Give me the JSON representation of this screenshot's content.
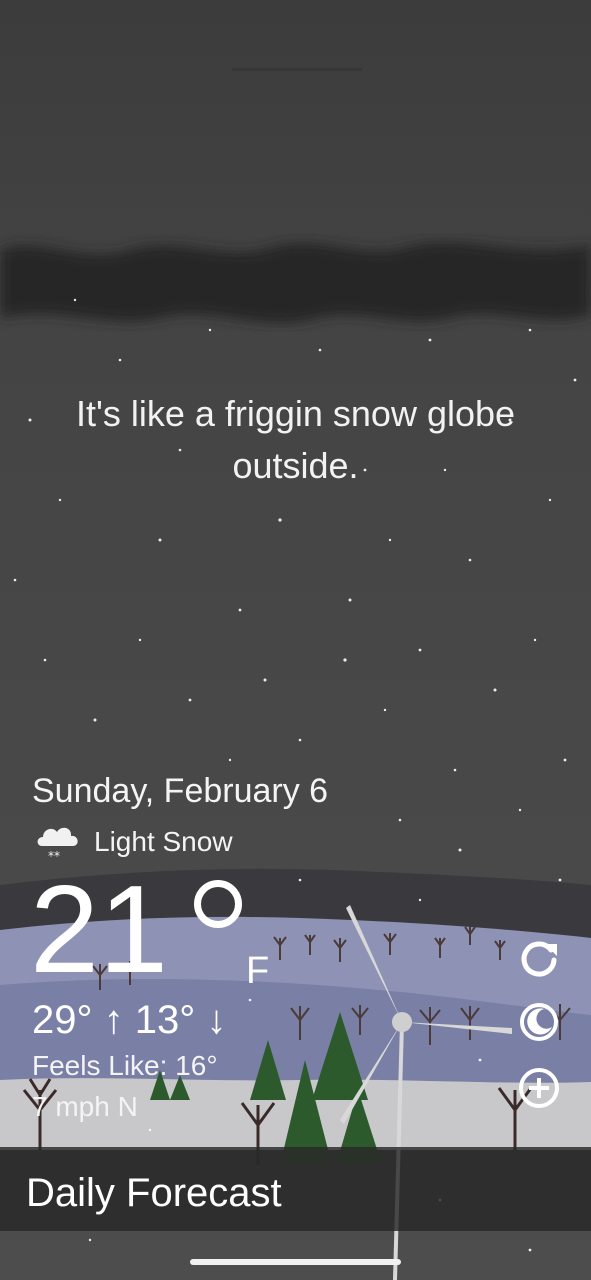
{
  "weather": {
    "quote": "It's like a friggin snow globe outside.",
    "date": "Sunday, February 6",
    "condition": "Light Snow",
    "condition_icon": "snow-cloud-icon",
    "temperature": "21",
    "unit": "F",
    "hi_lo": "29° ↑  13° ↓",
    "feels_like": "Feels Like: 16°",
    "wind": "7 mph N"
  },
  "actions": {
    "refresh_icon": "refresh-icon",
    "theme_icon": "moon-icon",
    "add_icon": "plus-circle-icon"
  },
  "forecast": {
    "label": "Daily Forecast"
  },
  "colors": {
    "sky": "#4a4a4a",
    "cloud": "#2a2a2a",
    "hill_far": "#8f94b8",
    "hill_near": "#6f739a",
    "ground": "#c9c9cb",
    "tree": "#2a4a2a"
  }
}
